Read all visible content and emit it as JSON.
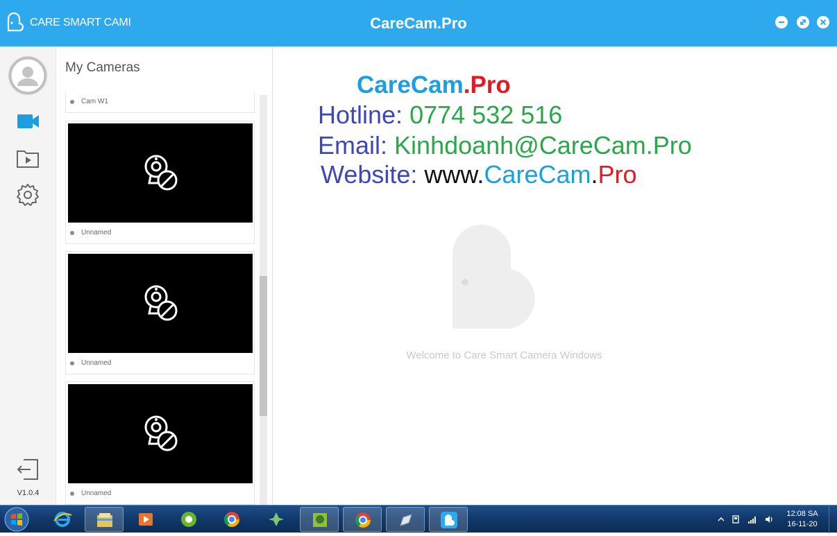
{
  "titlebar": {
    "app_name": "CARE SMART CAMI",
    "window_title": "CareCam.Pro",
    "minimize_label": "minimize",
    "restore_label": "restore",
    "close_label": "close"
  },
  "sidebar": {
    "version": "V1.0.4",
    "items": [
      {
        "name": "profile-avatar",
        "icon": "user-avatar-icon"
      },
      {
        "name": "cameras",
        "icon": "video-camera-icon",
        "active": true
      },
      {
        "name": "recordings",
        "icon": "folder-play-icon"
      },
      {
        "name": "settings",
        "icon": "gear-icon"
      },
      {
        "name": "logout",
        "icon": "logout-icon"
      }
    ]
  },
  "cameras": {
    "title": "My Cameras",
    "list": [
      {
        "label": "Cam W1",
        "thumbnail": false
      },
      {
        "label": "Unnamed",
        "thumbnail": true
      },
      {
        "label": "Unnamed",
        "thumbnail": true
      },
      {
        "label": "Unnamed",
        "thumbnail": true
      }
    ]
  },
  "main": {
    "brand_part1": "CareCam",
    "brand_dot": ".",
    "brand_part2": "Pro",
    "hotline_label": "Hotline:",
    "hotline_value": "0774 532 516",
    "email_label": "Email:",
    "email_value": "Kinhdoanh@CareCam.Pro",
    "website_label": "Website:",
    "website_www": "www.",
    "website_domain": "CareCam",
    "website_dot": ".",
    "website_tld": "Pro",
    "welcome": "Welcome to Care Smart Camera Windows"
  },
  "taskbar": {
    "clock_time": "12:08 SA",
    "clock_date": "16-11-20"
  },
  "colors": {
    "titlebar": "#2fa9ee",
    "brand_blue": "#1d9ee0",
    "brand_red": "#e21b23",
    "text_indigo": "#3d47b9",
    "text_green": "#29a84a"
  }
}
